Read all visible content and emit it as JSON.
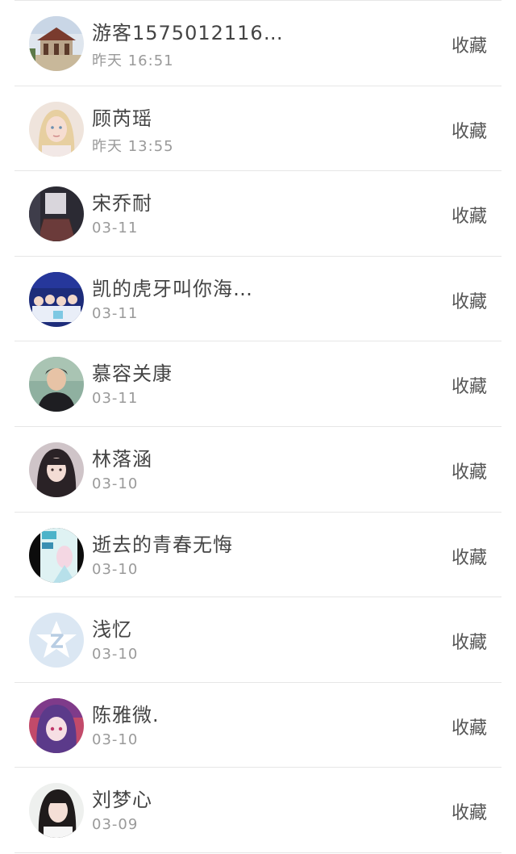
{
  "favorite_label": "收藏",
  "contacts": [
    {
      "name": "游客1575012116…",
      "time": "昨天 16:51",
      "avatar": "temple-photo"
    },
    {
      "name": "顾芮瑶",
      "time": "昨天 13:55",
      "avatar": "blonde-girl-photo"
    },
    {
      "name": "宋乔耐",
      "time": "03-11",
      "avatar": "girl-in-skirt-photo"
    },
    {
      "name": "凯的虎牙叫你海…",
      "time": "03-11",
      "avatar": "group-stage-photo"
    },
    {
      "name": "慕容关康",
      "time": "03-11",
      "avatar": "man-portrait-photo"
    },
    {
      "name": "林落涵",
      "time": "03-10",
      "avatar": "girl-portrait-photo"
    },
    {
      "name": "逝去的青春无悔",
      "time": "03-10",
      "avatar": "anime-poster-photo"
    },
    {
      "name": "浅忆",
      "time": "03-10",
      "avatar": "default-star-avatar"
    },
    {
      "name": "陈雅微.",
      "time": "03-10",
      "avatar": "anime-girl-illustration"
    },
    {
      "name": "刘梦心",
      "time": "03-09",
      "avatar": "girl-black-hair-photo"
    }
  ]
}
